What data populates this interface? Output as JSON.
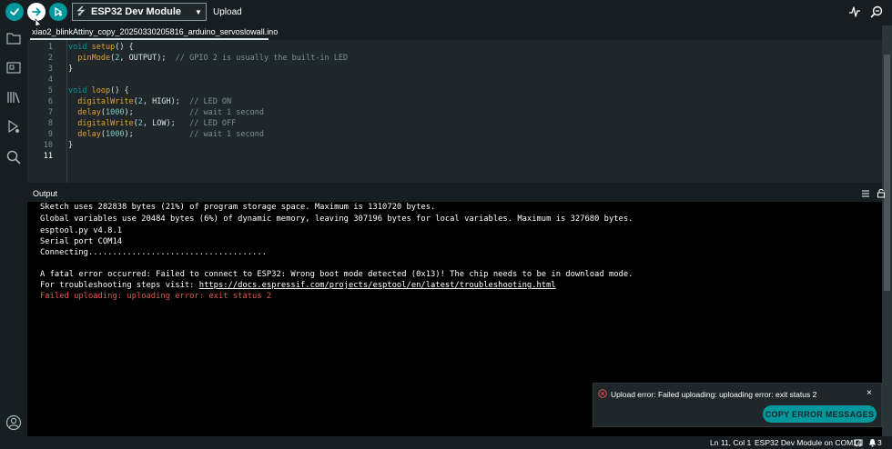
{
  "toolbar": {
    "board_name": "ESP32 Dev Module",
    "upload_label": "Upload"
  },
  "tab": {
    "filename": "xiao2_blinkAttiny_copy_20250330205816_arduino_servoslowall.ino"
  },
  "editor": {
    "line_numbers": [
      "1",
      "2",
      "3",
      "4",
      "5",
      "6",
      "7",
      "8",
      "9",
      "10",
      "11"
    ],
    "active_line": "11"
  },
  "code": {
    "l1_kw": "void",
    "l1_fn": "setup",
    "l1_rest": "() {",
    "l2_fn": "pinMode",
    "l2_open": "(",
    "l2_num": "2",
    "l2_mid": ", OUTPUT);  ",
    "l2_cm": "// GPIO 2 is usually the built-in LED",
    "l3": "}",
    "l5_kw": "void",
    "l5_fn": "loop",
    "l5_rest": "() {",
    "l6_fn": "digitalWrite",
    "l6_open": "(",
    "l6_num": "2",
    "l6_mid": ", HIGH);  ",
    "l6_cm": "// LED ON",
    "l7_fn": "delay",
    "l7_open": "(",
    "l7_num": "1000",
    "l7_mid": ");            ",
    "l7_cm": "// wait 1 second",
    "l8_fn": "digitalWrite",
    "l8_open": "(",
    "l8_num": "2",
    "l8_mid": ", LOW);   ",
    "l8_cm": "// LED OFF",
    "l9_fn": "delay",
    "l9_open": "(",
    "l9_num": "1000",
    "l9_mid": ");            ",
    "l9_cm": "// wait 1 second",
    "l10": "}"
  },
  "output": {
    "title": "Output",
    "lines": [
      "Sketch uses 282838 bytes (21%) of program storage space. Maximum is 1310720 bytes.",
      "Global variables use 20484 bytes (6%) of dynamic memory, leaving 307196 bytes for local variables. Maximum is 327680 bytes.",
      "esptool.py v4.8.1",
      "Serial port COM14",
      "Connecting.....................................",
      "A fatal error occurred: Failed to connect to ESP32: Wrong boot mode detected (0x13)! The chip needs to be in download mode."
    ],
    "troubleshoot_prefix": "For troubleshooting steps visit: ",
    "troubleshoot_link": "https://docs.espressif.com/projects/esptool/en/latest/troubleshooting.html",
    "error_line": "Failed uploading: uploading error: exit status 2"
  },
  "notification": {
    "message": "Upload error: Failed uploading: uploading error: exit status 2",
    "close": "×",
    "copy_label": "COPY ERROR MESSAGES"
  },
  "status": {
    "cursor": "Ln 11, Col 1",
    "board_port": "ESP32 Dev Module on COM14",
    "notif_count": "3"
  },
  "colors": {
    "accent": "#00979d",
    "error": "#e0584b",
    "background": "#171e21",
    "editor_bg": "#1f272a",
    "output_bg": "#000000"
  },
  "icons": [
    "check-icon",
    "arrow-right-icon",
    "debug-icon",
    "usb-icon",
    "chevron-down-icon",
    "pulse-icon",
    "serial-monitor-icon",
    "folder-icon",
    "boards-icon",
    "library-icon",
    "debug-sidebar-icon",
    "search-icon",
    "account-icon",
    "error-circle-icon",
    "close-icon",
    "clear-output-icon",
    "lock-icon",
    "bell-icon"
  ]
}
